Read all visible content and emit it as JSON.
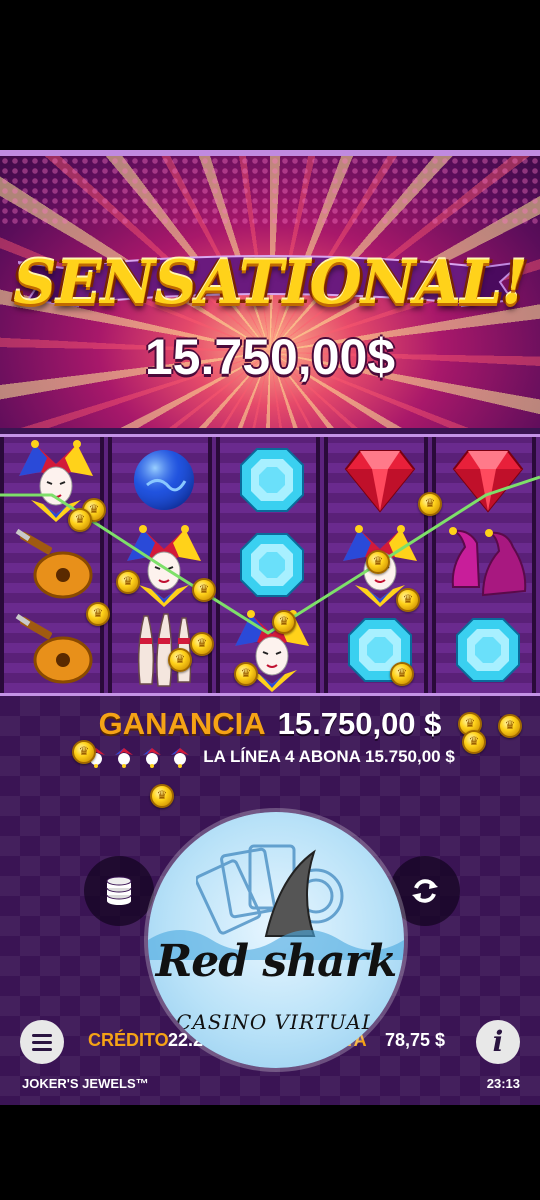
{
  "banner": {
    "headline": "SENSATIONAL!",
    "amount": "15.750,00$"
  },
  "reels": {
    "columns": [
      [
        "joker",
        "lute",
        "lute"
      ],
      [
        "blue-orb",
        "joker",
        "pins"
      ],
      [
        "cyan-gem",
        "cyan-gem",
        "joker"
      ],
      [
        "red-gem",
        "joker",
        "cyan-gem"
      ],
      [
        "red-gem",
        "jester-shoes",
        "cyan-gem"
      ]
    ]
  },
  "win": {
    "label": "GANANCIA",
    "value": "15.750,00 $",
    "line_text": "LA LÍNEA 4 ABONA 15.750,00 $"
  },
  "controls": {
    "coins_icon": "coin-stack-icon",
    "autoplay_icon": "autoplay-icon",
    "menu_icon": "hamburger-menu-icon",
    "info_label": "i"
  },
  "status": {
    "credit_label": "CRÉDITO",
    "credit_value": "22.25",
    "bet_label": "ESTA",
    "bet_value": "78,75 $"
  },
  "footer": {
    "title": "JOKER'S JEWELS™",
    "clock": "23:13"
  },
  "watermark": {
    "brand": "Red shark",
    "subtitle": "CASINO VIRTUAL"
  },
  "colors": {
    "accent_orange": "#f5a316",
    "headline_gold": "#ffd21a",
    "payline_green": "#7ee06a",
    "panel_purple": "#3a1454"
  }
}
